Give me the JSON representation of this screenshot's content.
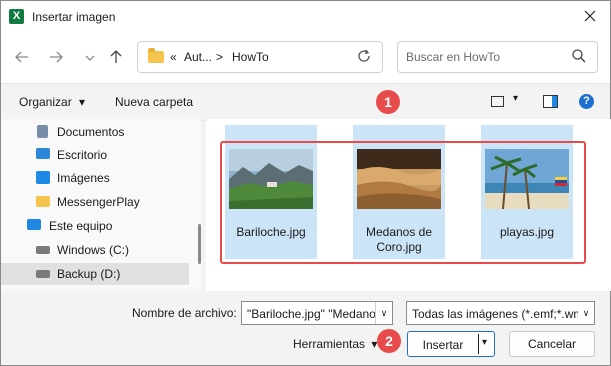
{
  "window": {
    "title": "Insertar imagen",
    "app_icon": "excel-icon"
  },
  "nav": {
    "back_icon": "arrow-left-icon",
    "forward_icon": "arrow-right-icon",
    "recent_icon": "chevron-down-icon",
    "up_icon": "arrow-up-icon",
    "breadcrumb": [
      "«",
      "Aut...",
      ">",
      "HowTo"
    ],
    "search_placeholder": "Buscar en HowTo"
  },
  "commandbar": {
    "organize": "Organizar",
    "organize_caret": "▾",
    "new_folder": "Nueva carpeta",
    "view_caret": "▾",
    "help": "?"
  },
  "sidebar": {
    "items": [
      {
        "label": "Documentos",
        "icon": "document-icon",
        "color": "#7a8ca8"
      },
      {
        "label": "Escritorio",
        "icon": "desktop-icon",
        "color": "#2b88d8"
      },
      {
        "label": "Imágenes",
        "icon": "pictures-icon",
        "color": "#1e88e5"
      },
      {
        "label": "MessengerPlay",
        "icon": "folder-icon",
        "color": "#f4c44d"
      },
      {
        "label": "Este equipo",
        "icon": "computer-icon",
        "color": "#1e88e5"
      },
      {
        "label": "Windows (C:)",
        "icon": "drive-icon",
        "color": "#7a7a7a"
      },
      {
        "label": "Backup (D:)",
        "icon": "drive-icon",
        "color": "#7a7a7a"
      }
    ]
  },
  "files": [
    {
      "name": "Bariloche.jpg"
    },
    {
      "name": "Medanos de Coro.jpg"
    },
    {
      "name": "playas.jpg"
    }
  ],
  "annotations": {
    "marker_1": "1",
    "marker_2": "2",
    "accent_color": "#e84b4b"
  },
  "footer": {
    "filename_label": "Nombre de archivo:",
    "filename_value": "\"Bariloche.jpg\" \"Medanos de Coro.jpg\" \"playas.jpg\"",
    "filetype_value": "Todas las imágenes (*.emf;*.wmf;*.jpg)",
    "tools_label": "Herramientas",
    "tools_caret": "▾",
    "insert_label": "Insertar",
    "insert_caret": "▾",
    "cancel_label": "Cancelar",
    "dropdown_caret": "∨"
  }
}
